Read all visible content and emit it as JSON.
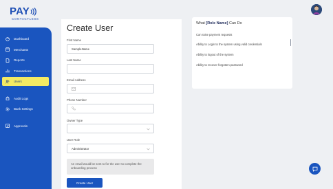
{
  "brand": {
    "name": "PAY",
    "subtitle": "CONTACTLESS",
    "color": "#1e4fb5"
  },
  "sidebar": {
    "color": "#1a55bf",
    "active_color": "#f4ea63",
    "items": [
      {
        "label": "Dashboard",
        "icon": "dashboard-icon"
      },
      {
        "label": "Merchants",
        "icon": "store-icon"
      },
      {
        "label": "Reports",
        "icon": "report-icon"
      },
      {
        "label": "Transactions",
        "icon": "transactions-icon"
      },
      {
        "label": "Users",
        "icon": "users-icon",
        "active": true
      },
      {
        "label": "Audit Logs",
        "icon": "lock-icon"
      },
      {
        "label": "Bank Settings",
        "icon": "settings-icon"
      },
      {
        "label": "Approvals",
        "icon": "approvals-icon"
      }
    ]
  },
  "form": {
    "title": "Create User",
    "first_name": {
      "label": "First Name",
      "value": "SampleName"
    },
    "last_name": {
      "label": "Last Name",
      "value": ""
    },
    "email": {
      "label": "Email Address",
      "value": ""
    },
    "phone": {
      "label": "Phone Number",
      "value": ""
    },
    "owner_type": {
      "label": "Owner Type",
      "value": ""
    },
    "user_role": {
      "label": "User Role",
      "value": "Administrator"
    },
    "note": "An email would be sent to for the user to complete the onboarding process",
    "submit_label": "Create User"
  },
  "permissions": {
    "title_prefix": "What ",
    "role": "[Role Name]",
    "title_suffix": " Can Do",
    "items": [
      "Can raise payment requests",
      "Ability to Login to the system using valid credentials",
      "Ability to logout of the system",
      "Ability to recover forgotten password"
    ]
  },
  "icons": {
    "avatar": "avatar-icon",
    "chat": "chat-icon"
  }
}
